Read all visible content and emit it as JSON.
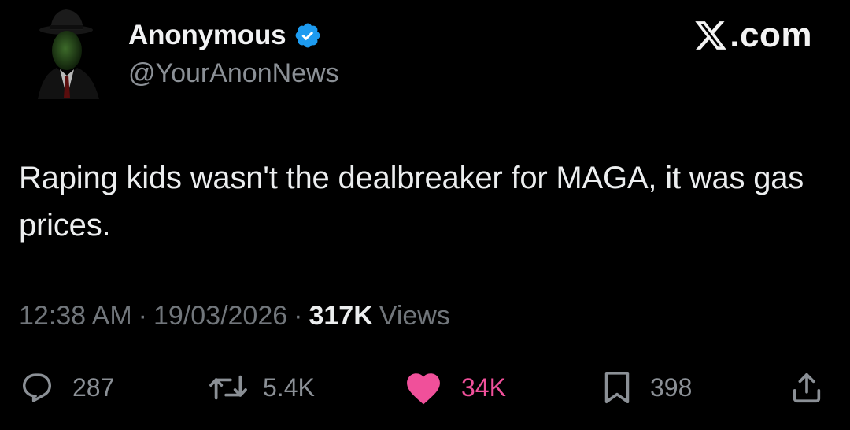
{
  "author": {
    "display_name": "Anonymous",
    "handle": "@YourAnonNews",
    "verified": true,
    "avatar_icon": "anonymous-silhouette-avatar"
  },
  "site": {
    "label": ".com",
    "icon": "x-logo-icon"
  },
  "tweet": {
    "text": "Raping kids wasn't the dealbreaker for MAGA, it was gas prices."
  },
  "meta": {
    "time": "12:38 AM",
    "date": "19/03/2026",
    "separator": "·",
    "views_count": "317K",
    "views_label": "Views"
  },
  "actions": {
    "reply": {
      "icon": "reply-icon",
      "count": "287"
    },
    "repost": {
      "icon": "repost-icon",
      "count": "5.4K"
    },
    "like": {
      "icon": "heart-icon",
      "count": "34K",
      "liked": true
    },
    "bookmark": {
      "icon": "bookmark-icon",
      "count": "398"
    },
    "share": {
      "icon": "share-icon"
    }
  },
  "colors": {
    "background": "#000000",
    "verified_badge": "#1d9bf0",
    "like_active": "#f0509a",
    "secondary_text": "#71767b",
    "primary_text": "#e7e9ea"
  }
}
